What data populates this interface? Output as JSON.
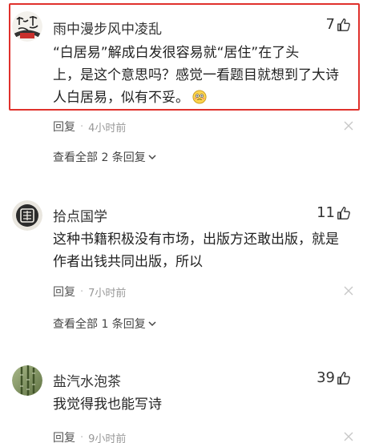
{
  "comments": [
    {
      "username": "雨中漫步风中凌乱",
      "likes": "7",
      "lines": [
        "“白居易”解成白发很容易就“居住”在了头",
        "上，是这个意思吗？感觉一看题目就想到了大诗",
        "人白居易，似有不妥。"
      ],
      "reply_label": "回复",
      "separator": "·",
      "time": "4小时前",
      "view_all": "查看全部 2 条回复",
      "avatar_icon": "calligraphy-avatar",
      "highlighted": true
    },
    {
      "username": "拾点国学",
      "likes": "11",
      "lines": [
        "这种书籍积极没有市场，出版方还敢出版，就是",
        "作者出钱共同出版，所以"
      ],
      "reply_label": "回复",
      "separator": "·",
      "time": "7小时前",
      "view_all": "查看全部 1 条回复",
      "avatar_icon": "seal-avatar"
    },
    {
      "username": "盐汽水泡茶",
      "likes": "39",
      "lines": [
        "我觉得我也能写诗"
      ],
      "reply_label": "回复",
      "separator": "·",
      "time": "9小时前",
      "avatar_icon": "bamboo-avatar"
    }
  ],
  "icons": {
    "like": "thumbs-up-icon",
    "close": "close-icon",
    "expand": "chevron-down-icon",
    "emoji": "embarrassed-emoji-icon"
  },
  "colors": {
    "highlight_border": "#e0312c",
    "meta_text": "#999999"
  }
}
